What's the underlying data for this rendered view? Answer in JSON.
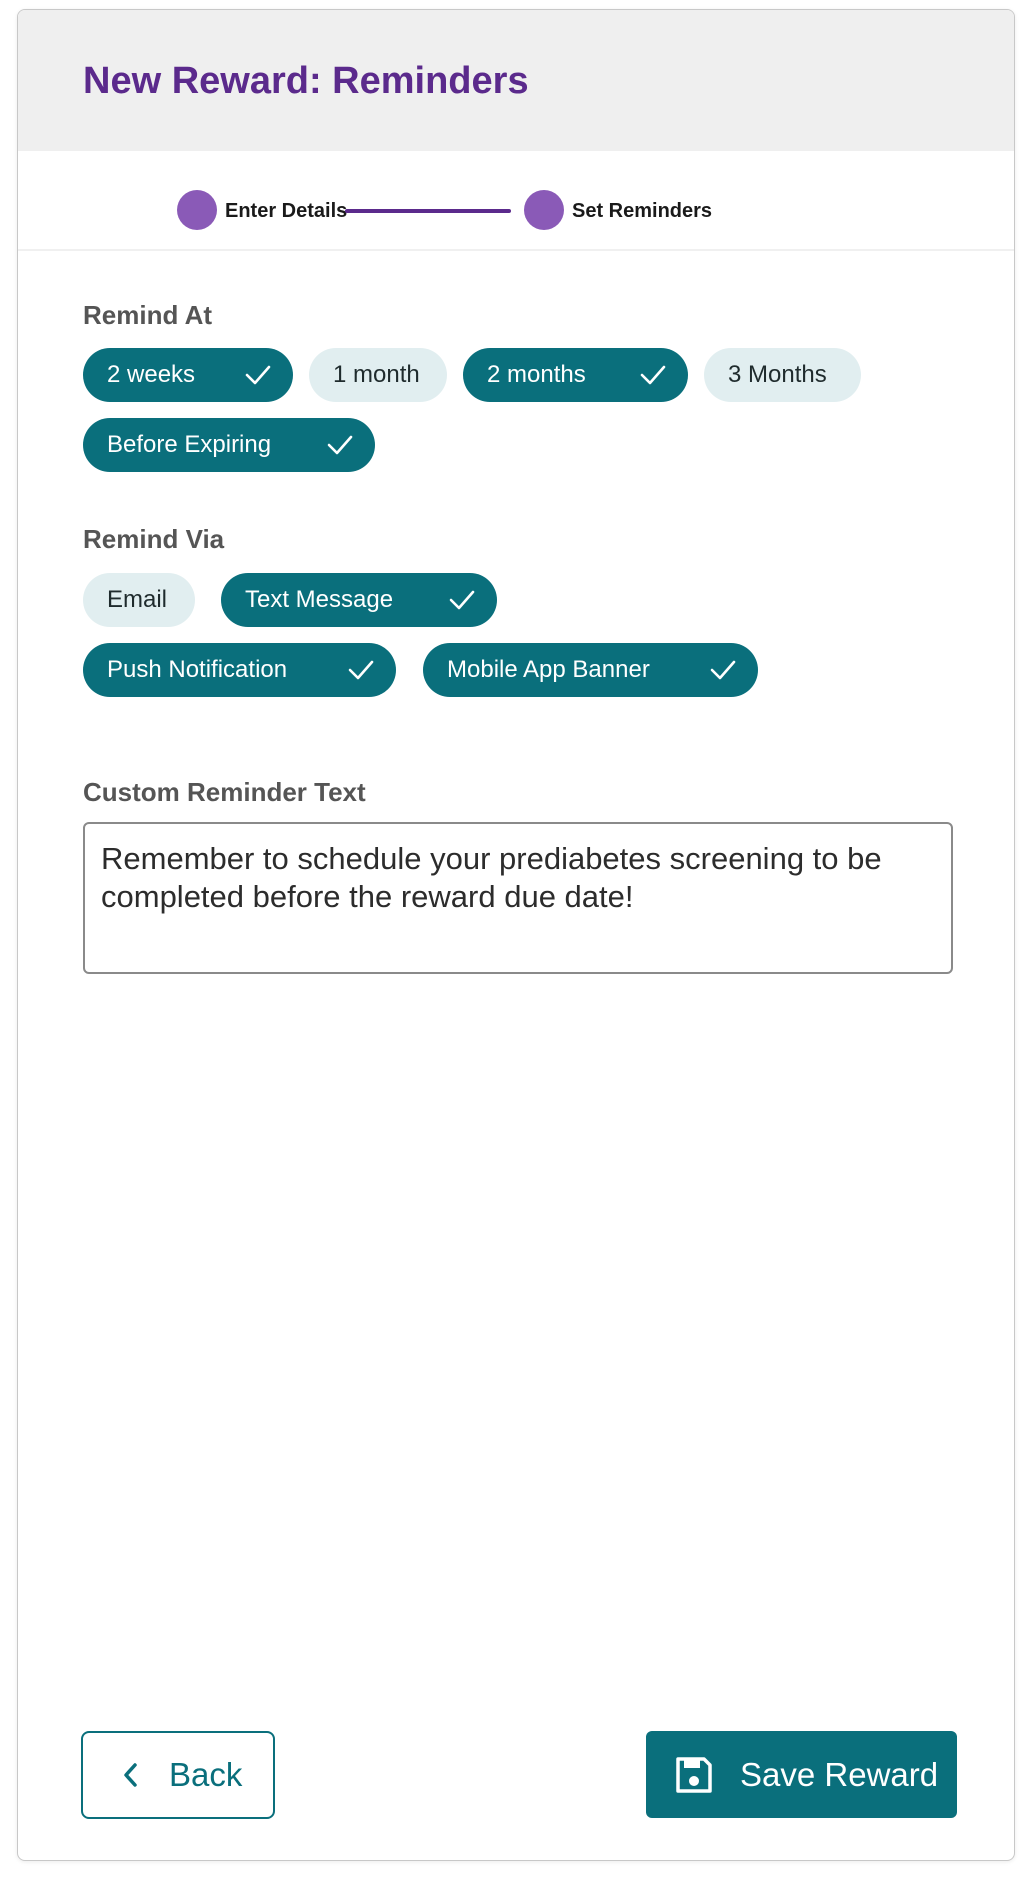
{
  "header": {
    "title": "New Reward: Reminders"
  },
  "stepper": {
    "steps": [
      {
        "label": "Enter Details",
        "completed": true
      },
      {
        "label": "Set Reminders",
        "completed": true
      }
    ]
  },
  "remind_at": {
    "label": "Remind At",
    "options": [
      {
        "label": "2 weeks",
        "selected": true
      },
      {
        "label": "1 month",
        "selected": false
      },
      {
        "label": "2 months",
        "selected": true
      },
      {
        "label": "3 Months",
        "selected": false
      },
      {
        "label": "Before Expiring",
        "selected": true
      }
    ]
  },
  "remind_via": {
    "label": "Remind Via",
    "options": [
      {
        "label": "Email",
        "selected": false
      },
      {
        "label": "Text Message",
        "selected": true
      },
      {
        "label": "Push Notification",
        "selected": true
      },
      {
        "label": "Mobile App Banner",
        "selected": true
      }
    ]
  },
  "custom_text": {
    "label": "Custom Reminder Text",
    "value": "Remember to schedule your prediabetes screening to be completed before the reward due date!"
  },
  "footer": {
    "back_label": "Back",
    "save_label": "Save Reward"
  },
  "colors": {
    "accent": "#0a6f7c",
    "title": "#5b2a8c",
    "step_dot": "#8a5ab7",
    "chip_off": "#e1eef0"
  }
}
